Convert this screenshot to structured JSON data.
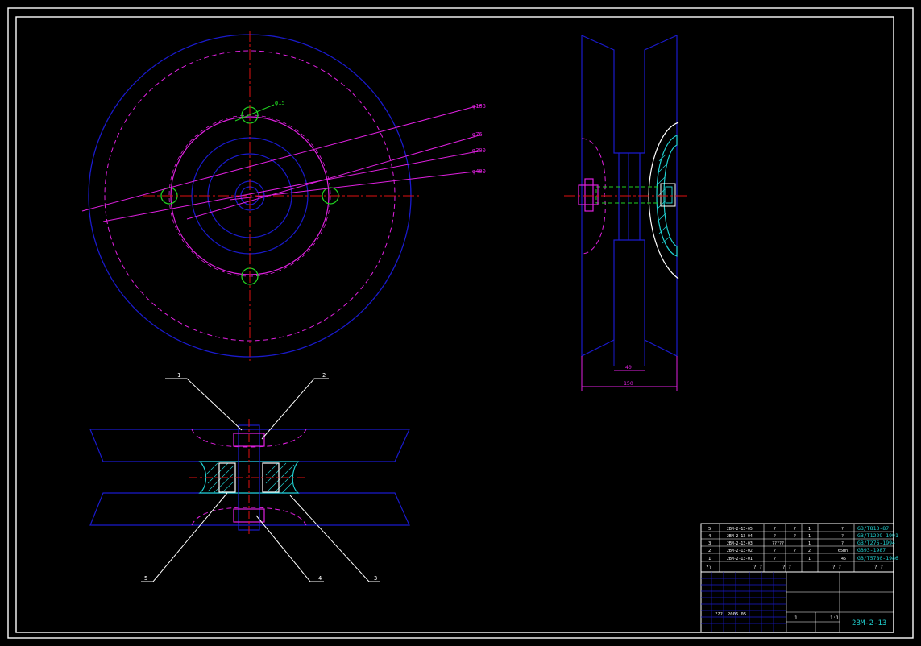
{
  "colors": {
    "background": "#000000",
    "border": "#ffffff",
    "outline": "#1a1acc",
    "centerline": "#e01010",
    "hidden": "#e020e0",
    "bolt": "#20d020",
    "hatch": "#20d0d0",
    "leader": "#ffffff",
    "text_cyan": "#20d0d0",
    "text_yellow": "#e0e020",
    "text_white": "#ffffff"
  },
  "front_view": {
    "dim_labels": [
      "φ15",
      "φ168",
      "φ76",
      "φ300",
      "φ400"
    ]
  },
  "side_view": {
    "dims": [
      "40",
      "150"
    ]
  },
  "section_view": {
    "callouts": [
      "1",
      "2",
      "5",
      "4",
      "3"
    ]
  },
  "bom": {
    "rows": [
      {
        "no": "5",
        "code": "2BM-2-13-05",
        "c3": "?",
        "c4": "?",
        "c5": "1",
        "c6": "?",
        "std": "GB/T813-87"
      },
      {
        "no": "4",
        "code": "2BM-2-13-04",
        "c3": "?",
        "c4": "?",
        "c5": "1",
        "c6": "?",
        "std": "GB/T1229-1991"
      },
      {
        "no": "3",
        "code": "2BM-2-13-03",
        "c3": "?????",
        "c4": "",
        "c5": "1",
        "c6": "?",
        "std": "GB/T276-1994"
      },
      {
        "no": "2",
        "code": "2BM-2-13-02",
        "c3": "?",
        "c4": "?",
        "c5": "2",
        "c6": "65Mn",
        "std": "GB93-1987"
      },
      {
        "no": "1",
        "code": "2BM-2-13-01",
        "c3": "?",
        "c4": "",
        "c5": "1",
        "c6": "45",
        "std": "GB/T5780-1986"
      }
    ],
    "header": [
      "??",
      "? ?",
      "? ?",
      "? ?",
      "? ?"
    ]
  },
  "title_block": {
    "designer": "???",
    "date": "2006.05",
    "scale_label": "1:1",
    "sheet": "1",
    "drawing_no": "2BM-2-13"
  }
}
